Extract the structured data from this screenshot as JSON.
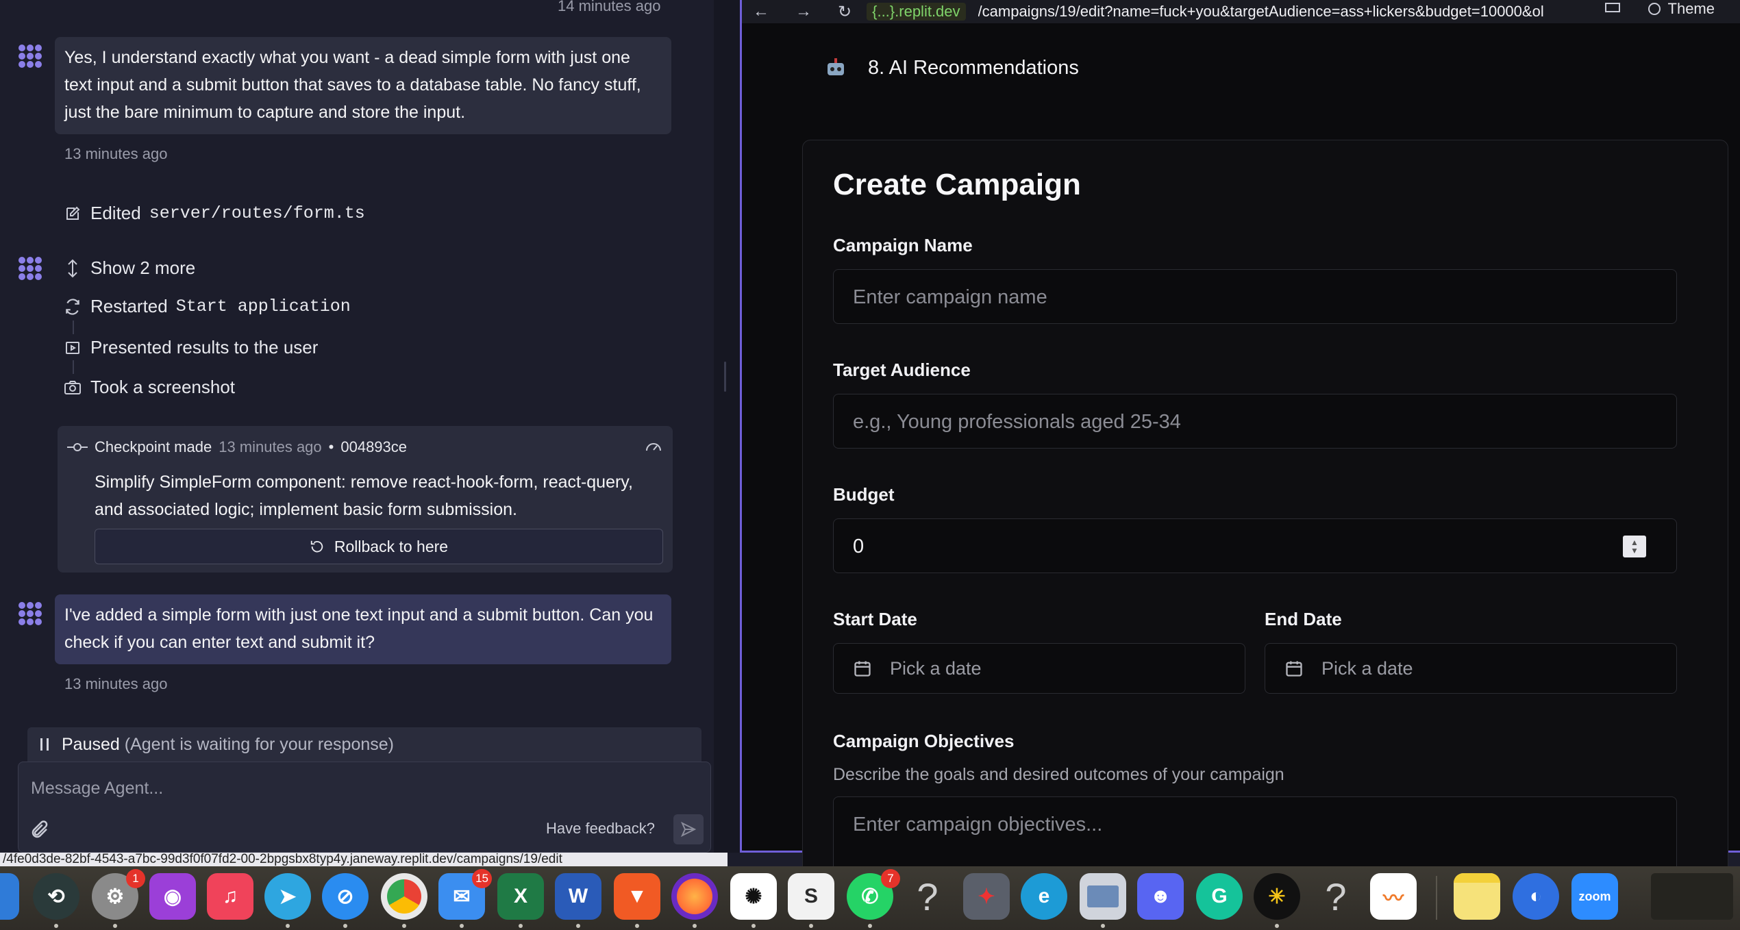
{
  "chat": {
    "top_timestamp": "14 minutes ago",
    "msg1": "Yes, I understand exactly what you want - a dead simple form with just one text input and a submit button that saves to a database table. No fancy stuff, just the bare minimum to capture and store the input.",
    "msg1_time": "13 minutes ago",
    "edited_label": "Edited",
    "edited_file": "server/routes/form.ts",
    "show_more": "Show 2 more",
    "restarted_label": "Restarted",
    "restarted_target": "Start application",
    "presented": "Presented results to the user",
    "screenshot": "Took a screenshot",
    "checkpoint": {
      "label": "Checkpoint made",
      "time": "13 minutes ago",
      "sep": "•",
      "hash": "004893ce",
      "text": "Simplify SimpleForm component: remove react-hook-form, react-query, and associated logic; implement basic form submission.",
      "rollback": "Rollback to here"
    },
    "msg2": "I've added a simple form with just one text input and a submit button. Can you check if you can enter text and submit it?",
    "msg2_time": "13 minutes ago",
    "paused": "Paused",
    "paused_detail": "(Agent is waiting for your response)",
    "composer_placeholder": "Message Agent...",
    "feedback": "Have feedback?"
  },
  "status_url": "/4fe0d3de-82bf-4543-a7bc-99d3f0f07fd2-00-2bpgsbx8typ4y.janeway.replit.dev/campaigns/19/edit",
  "browser": {
    "domain": "{...}.replit.dev",
    "path": "/campaigns/19/edit?name=fuck+you&targetAudience=ass+lickers&budget=10000&ol",
    "theme": "Theme"
  },
  "preview": {
    "section": "8. AI Recommendations",
    "title": "Create Campaign",
    "name_label": "Campaign Name",
    "name_placeholder": "Enter campaign name",
    "audience_label": "Target Audience",
    "audience_placeholder": "e.g., Young professionals aged 25-34",
    "budget_label": "Budget",
    "budget_value": "0",
    "start_label": "Start Date",
    "start_placeholder": "Pick a date",
    "end_label": "End Date",
    "end_placeholder": "Pick a date",
    "objectives_label": "Campaign Objectives",
    "objectives_help": "Describe the goals and desired outcomes of your campaign",
    "objectives_placeholder": "Enter campaign objectives..."
  },
  "dock": {
    "badges": {
      "system_settings": "1",
      "mail": "15",
      "whatsapp": "7"
    },
    "zoom_label": "zoom",
    "icons": [
      "finder-icon",
      "time-machine-icon",
      "system-settings-icon",
      "podcasts-icon",
      "music-icon",
      "telegram-icon",
      "safari-icon",
      "chrome-icon",
      "mail-icon",
      "excel-icon",
      "word-icon",
      "brave-icon",
      "firefox-icon",
      "chatgpt-icon",
      "scrivener-icon",
      "whatsapp-icon",
      "unknown-app-icon",
      "affinity-icon",
      "edge-icon",
      "preview-icon",
      "discord-icon",
      "grammarly-icon",
      "keeper-icon",
      "unknown-app-icon",
      "freeform-icon",
      "notes-icon",
      "screens-icon",
      "zoom-icon"
    ]
  }
}
